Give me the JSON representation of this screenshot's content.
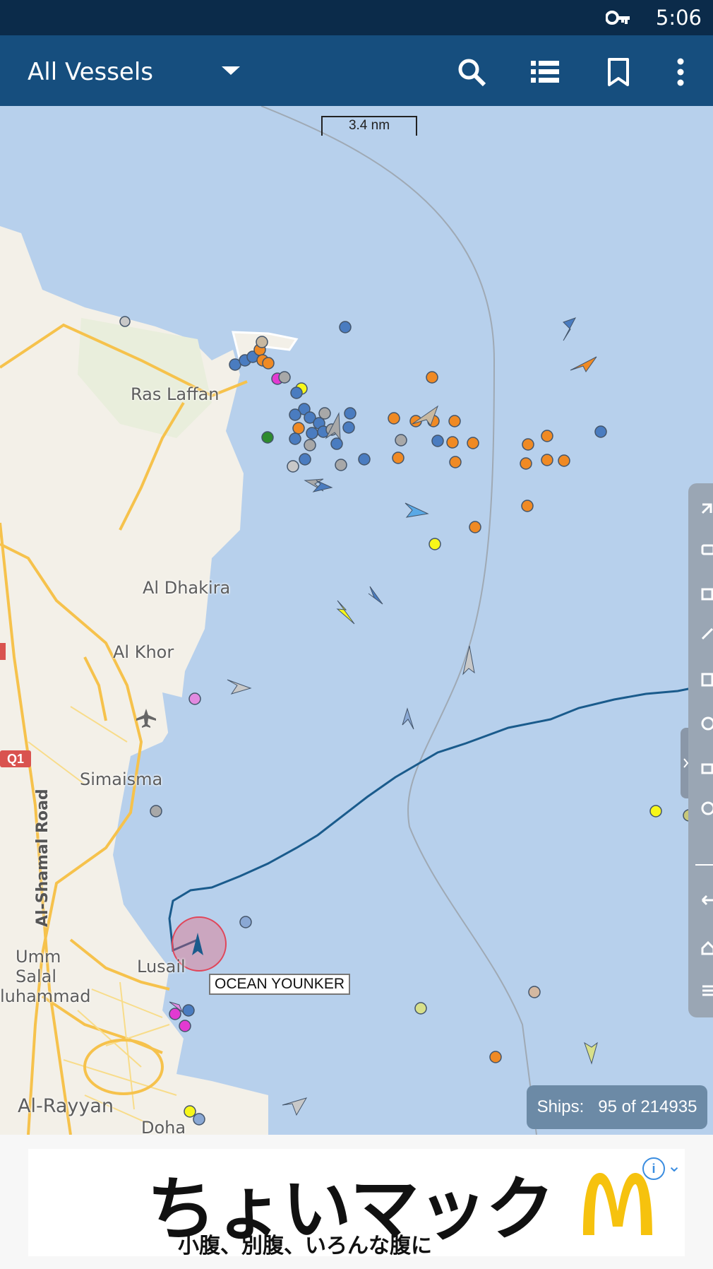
{
  "status_bar": {
    "time": "5:06",
    "vpn_icon": "key-icon"
  },
  "app_bar": {
    "title": "All Vessels",
    "dropdown_icon": "caret-down-icon",
    "actions": [
      "search-icon",
      "list-view-icon",
      "bookmark-icon",
      "more-vert-icon"
    ]
  },
  "map": {
    "scale_label": "3.4 nm",
    "places": {
      "ras_laffan": "Ras Laffan",
      "al_dhakira": "Al Dhakira",
      "al_khor": "Al Khor",
      "simaisma": "Simaisma",
      "lusail": "Lusail",
      "umm": "Umm",
      "salal": "Salal",
      "muhammad": "luhammad",
      "al_rayyan": "Al-Rayyan",
      "doha": "Doha"
    },
    "road_labels": {
      "q1": "Q1",
      "al_shamal": "Al-Shamal Road"
    },
    "selected_vessel_label": "OCEAN YOUNKER",
    "ships_counter": {
      "label": "Ships:",
      "count": "95 of 214935"
    },
    "colors": {
      "water": "#b7d0ec",
      "land": "#f3f0e8",
      "cargo_vessel": "#4a7cc0",
      "tanker_vessel": "#f08a24",
      "passenger_vessel": "#e23ad1",
      "unknown_vessel": "#a8a8a8",
      "fishing_vessel": "#f7f71a",
      "track_line": "#1a5b8c"
    }
  },
  "ad": {
    "headline": "ちょいマック",
    "subline": "小腹、別腹、いろんな腹に",
    "brand_logo": "mcdonalds-logo",
    "info_icon": "ad-info-icon",
    "close_icon": "ad-close-icon"
  }
}
